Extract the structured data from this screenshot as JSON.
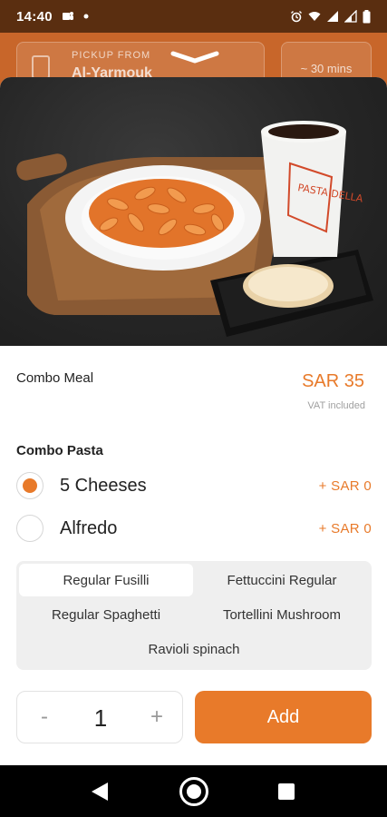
{
  "status_bar": {
    "time": "14:40",
    "icons": [
      "teams-icon",
      "notification-dot-icon",
      "alarm-icon",
      "wifi-icon",
      "signal-icon",
      "signal-icon",
      "battery-icon"
    ]
  },
  "header": {
    "pickup_label": "PICKUP FROM",
    "pickup_location": "Al-Yarmouk",
    "eta": "~ 30 mins"
  },
  "product": {
    "name": "Combo Meal",
    "price": "SAR 35",
    "vat_note": "VAT included"
  },
  "section": {
    "title": "Combo Pasta",
    "options": [
      {
        "label": "5 Cheeses",
        "price": "+ SAR 0",
        "selected": true
      },
      {
        "label": "Alfredo",
        "price": "+ SAR 0",
        "selected": false
      }
    ]
  },
  "variants": [
    {
      "label": "Regular Fusilli",
      "selected": true
    },
    {
      "label": "Fettuccini Regular",
      "selected": false
    },
    {
      "label": "Regular Spaghetti",
      "selected": false
    },
    {
      "label": "Tortellini Mushroom",
      "selected": false
    },
    {
      "label": "Ravioli spinach",
      "selected": false
    }
  ],
  "stepper": {
    "minus": "-",
    "quantity": "1",
    "plus": "+"
  },
  "add_button": {
    "label": "Add"
  },
  "hero": {
    "cup_brand": "PASTA DELLA"
  },
  "colors": {
    "accent": "#e87a2a",
    "header": "#c8662a",
    "status_bar": "#5a2e10"
  }
}
